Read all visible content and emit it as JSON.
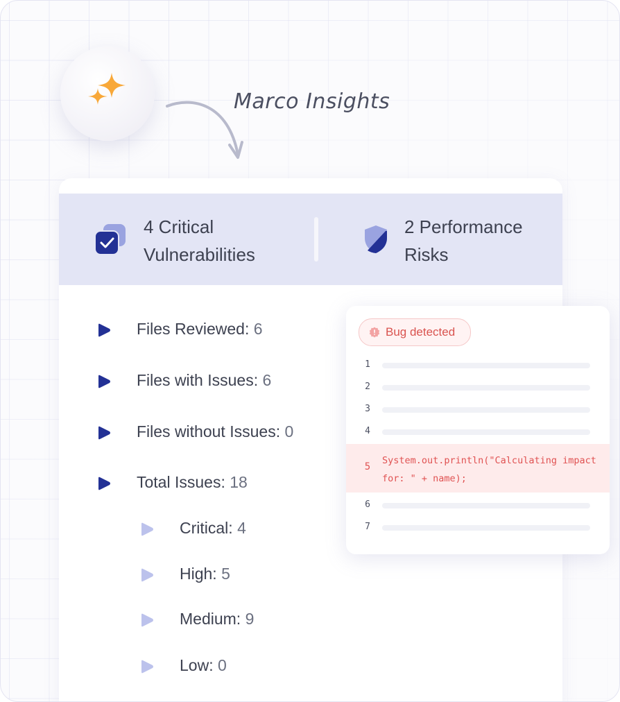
{
  "brand": {
    "name": "Marco Insights"
  },
  "colors": {
    "accent": "#233195",
    "accent_light": "#bcc2ec",
    "sparkle": "#f8a839",
    "stats_band": "#e3e5f5",
    "bug_red": "#e05252"
  },
  "stats": [
    {
      "icon": "checkbox-stack-icon",
      "line1": "4 Critical",
      "line2": "Vulnerabilities"
    },
    {
      "icon": "shield-icon",
      "line1": "2 Performance",
      "line2": "Risks"
    }
  ],
  "summary": [
    {
      "label": "Files Reviewed:",
      "value": "6",
      "level": 0
    },
    {
      "label": "Files with Issues:",
      "value": "6",
      "level": 0
    },
    {
      "label": "Files without Issues:",
      "value": "0",
      "level": 0
    },
    {
      "label": "Total Issues:",
      "value": "18",
      "level": 0
    },
    {
      "label": "Critical:",
      "value": "4",
      "level": 1
    },
    {
      "label": "High:",
      "value": "5",
      "level": 1
    },
    {
      "label": "Medium:",
      "value": "9",
      "level": 1
    },
    {
      "label": "Low:",
      "value": "0",
      "level": 1
    }
  ],
  "code": {
    "badge": "Bug detected",
    "lines": [
      "1",
      "2",
      "3",
      "4",
      "6",
      "7"
    ],
    "highlight": {
      "line": "5",
      "source": "System.out.println(\"Calculating impact for: \" + name);"
    }
  }
}
